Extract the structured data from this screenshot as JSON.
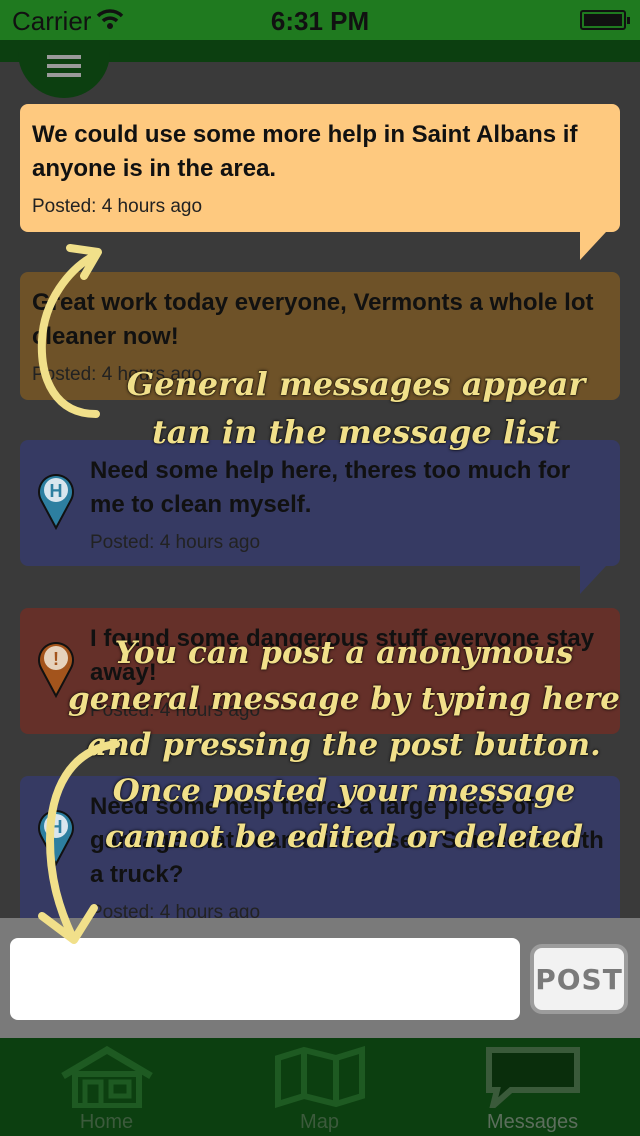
{
  "status_bar": {
    "carrier": "Carrier",
    "time": "6:31 PM"
  },
  "messages": [
    {
      "text": "We could use some more help in Saint Albans if anyone is in the area.",
      "posted": "Posted: 4 hours ago",
      "kind": "general",
      "color": "#fec97f"
    },
    {
      "text": "Great work today everyone, Vermonts a whole lot cleaner now!",
      "posted": "Posted: 4 hours ago",
      "kind": "general",
      "color": "#7a5b2a"
    },
    {
      "text": "Need some help here, theres too much for me to clean myself.",
      "posted": "Posted: 4 hours ago",
      "kind": "help",
      "color": "#3a3f6a"
    },
    {
      "text": "I found some dangerous stuff everyone stay away!",
      "posted": "Posted: 4 hours ago",
      "kind": "danger",
      "color": "#6a3030"
    },
    {
      "text": "Need some help theres a large piece of garbage that I can't lift myself. Someone with a truck?",
      "posted": "Posted: 4 hours ago",
      "kind": "help",
      "color": "#3a3f6a"
    }
  ],
  "annotations": {
    "general": "General messages appear tan in the message list",
    "post": "You can post a anonymous general message by typing here and pressing the post button. Once posted your message cannot be edited or deleted"
  },
  "composer": {
    "placeholder": "",
    "post_label": "POST"
  },
  "tabs": [
    {
      "label": "Home",
      "icon": "house-icon"
    },
    {
      "label": "Map",
      "icon": "map-icon"
    },
    {
      "label": "Messages",
      "icon": "speech-bubble-icon"
    }
  ]
}
